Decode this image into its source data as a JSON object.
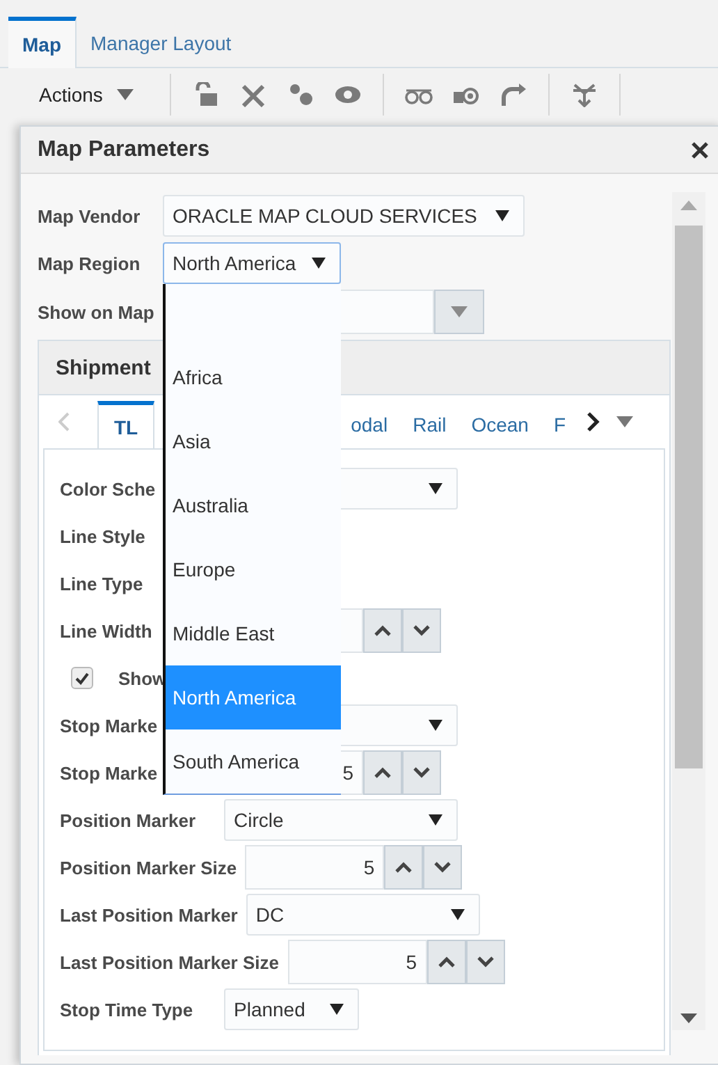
{
  "tabs": [
    {
      "label": "Map",
      "selected": true
    },
    {
      "label": "Manager Layout",
      "selected": false
    }
  ],
  "toolbar": {
    "actions_menu": "Actions"
  },
  "dialog": {
    "title": "Map Parameters",
    "fields": [
      {
        "label": "Map Vendor",
        "kind": "select",
        "value": "ORACLE MAP CLOUD SERVICES"
      },
      {
        "label": "Map Region",
        "kind": "select",
        "value": "North America",
        "open": true
      },
      {
        "label": "Show on Map",
        "kind": "combo"
      }
    ],
    "region_options": [
      {
        "label": "Africa",
        "selected": false
      },
      {
        "label": "Asia",
        "selected": false
      },
      {
        "label": "Australia",
        "selected": false
      },
      {
        "label": "Europe",
        "selected": false
      },
      {
        "label": "Middle East",
        "selected": false
      },
      {
        "label": "North America",
        "selected": true
      },
      {
        "label": "South America",
        "selected": false
      }
    ],
    "shipments": {
      "title": "Shipment",
      "tabs": [
        {
          "label": "TL",
          "selected": true
        },
        {
          "label": "odal",
          "selected": false
        },
        {
          "label": "Rail",
          "selected": false
        },
        {
          "label": "Ocean",
          "selected": false
        },
        {
          "label": "F",
          "selected": false
        }
      ],
      "rows": [
        {
          "label": "Color Sche",
          "kind": "select"
        },
        {
          "label": "Line Style",
          "kind": "label"
        },
        {
          "label": "Line Type",
          "kind": "label"
        },
        {
          "label": "Line Width",
          "kind": "spinner"
        },
        {
          "label": "Show",
          "kind": "checkbox",
          "checked": true
        },
        {
          "label": "Stop Marke",
          "kind": "select"
        },
        {
          "label": "Stop Marke",
          "kind": "spinner",
          "value": "5"
        },
        {
          "label": "Position Marker",
          "kind": "select",
          "value": "Circle"
        },
        {
          "label": "Position Marker Size",
          "kind": "spinner",
          "value": "5"
        },
        {
          "label": "Last Position Marker",
          "kind": "select",
          "value": "DC"
        },
        {
          "label": "Last Position Marker Size",
          "kind": "spinner",
          "value": "5"
        },
        {
          "label": "Stop Time Type",
          "kind": "select",
          "value": "Planned"
        }
      ]
    }
  }
}
